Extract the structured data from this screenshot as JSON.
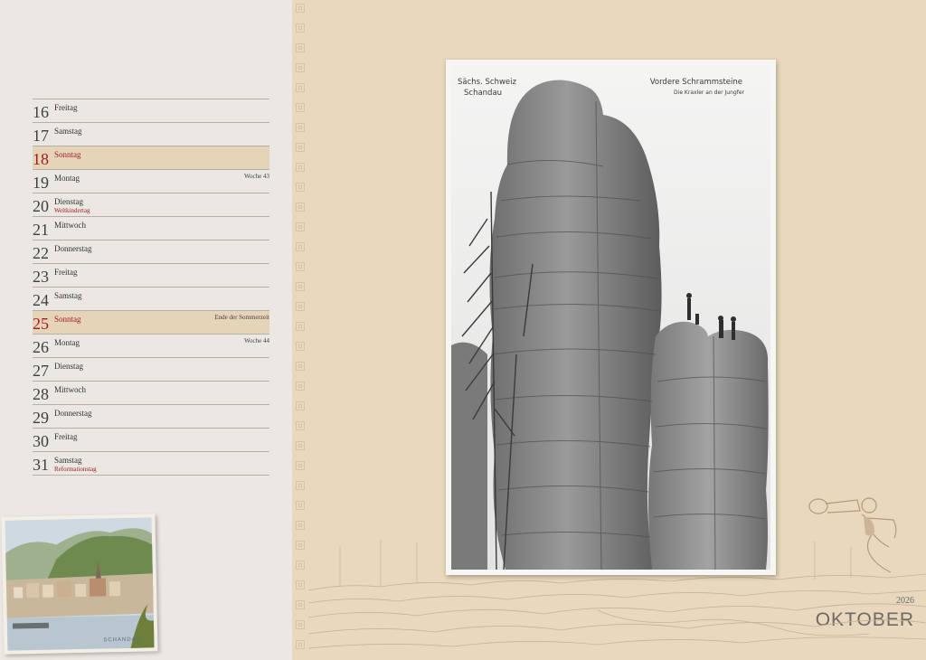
{
  "calendar": {
    "year": "2026",
    "month": "OKTOBER",
    "days": [
      {
        "num": "16",
        "weekday": "Freitag"
      },
      {
        "num": "17",
        "weekday": "Samstag"
      },
      {
        "num": "18",
        "weekday": "Sonntag",
        "sunday": true
      },
      {
        "num": "19",
        "weekday": "Montag",
        "note": "Woche 43"
      },
      {
        "num": "20",
        "weekday": "Dienstag",
        "holiday": "Weltkindertag"
      },
      {
        "num": "21",
        "weekday": "Mittwoch"
      },
      {
        "num": "22",
        "weekday": "Donnerstag"
      },
      {
        "num": "23",
        "weekday": "Freitag"
      },
      {
        "num": "24",
        "weekday": "Samstag"
      },
      {
        "num": "25",
        "weekday": "Sonntag",
        "sunday": true,
        "note": "Ende der Sommerzeit"
      },
      {
        "num": "26",
        "weekday": "Montag",
        "note": "Woche 44"
      },
      {
        "num": "27",
        "weekday": "Dienstag"
      },
      {
        "num": "28",
        "weekday": "Mittwoch"
      },
      {
        "num": "29",
        "weekday": "Donnerstag"
      },
      {
        "num": "30",
        "weekday": "Freitag"
      },
      {
        "num": "31",
        "weekday": "Samstag",
        "holiday": "Reformationstag"
      }
    ]
  },
  "photo": {
    "caption_left_1": "Sächs. Schweiz",
    "caption_left_2": "Schandau",
    "caption_right_1": "Vordere Schrammsteine",
    "caption_right_2": "Die Kraxler an der Jungfer"
  },
  "postcard": {
    "caption": "SCHANDAU"
  },
  "colors": {
    "sunday_text": "#a11c1c",
    "sunday_bg": "#e6d4b9",
    "right_bg": "#e9d8bd",
    "left_bg": "#ebe7e3"
  }
}
